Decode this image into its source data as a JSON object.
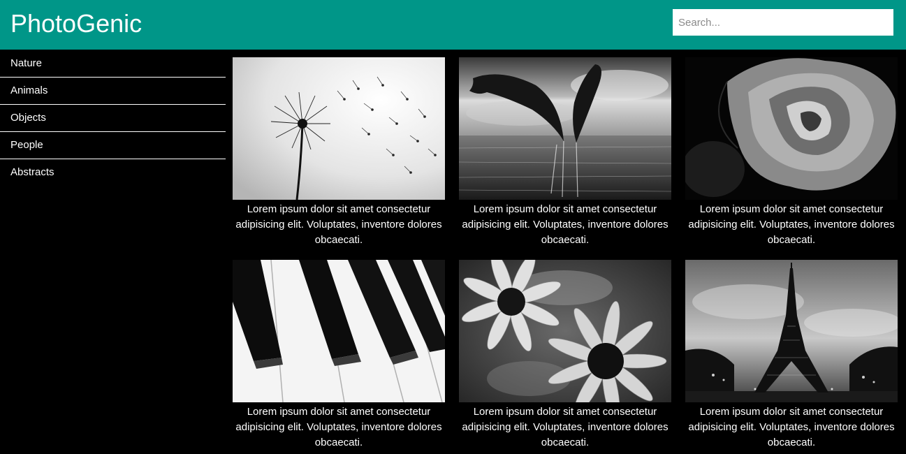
{
  "header": {
    "brand": "PhotoGenic",
    "search_placeholder": "Search...",
    "background": "#009688"
  },
  "sidebar": {
    "items": [
      {
        "label": "Nature"
      },
      {
        "label": "Animals"
      },
      {
        "label": "Objects"
      },
      {
        "label": "People"
      },
      {
        "label": "Abstracts"
      }
    ]
  },
  "gallery": {
    "cards": [
      {
        "image": "dandelion-photo",
        "caption": "Lorem ipsum dolor sit amet consectetur adipisicing elit. Voluptates, inventore dolores obcaecati."
      },
      {
        "image": "dolphins-photo",
        "caption": "Lorem ipsum dolor sit amet consectetur adipisicing elit. Voluptates, inventore dolores obcaecati."
      },
      {
        "image": "rose-photo",
        "caption": "Lorem ipsum dolor sit amet consectetur adipisicing elit. Voluptates, inventore dolores obcaecati."
      },
      {
        "image": "piano-keys-photo",
        "caption": "Lorem ipsum dolor sit amet consectetur adipisicing elit. Voluptates, inventore dolores obcaecati."
      },
      {
        "image": "daisies-photo",
        "caption": "Lorem ipsum dolor sit amet consectetur adipisicing elit. Voluptates, inventore dolores obcaecati."
      },
      {
        "image": "eiffel-tower-photo",
        "caption": "Lorem ipsum dolor sit amet consectetur adipisicing elit. Voluptates, inventore dolores obcaecati."
      }
    ]
  }
}
